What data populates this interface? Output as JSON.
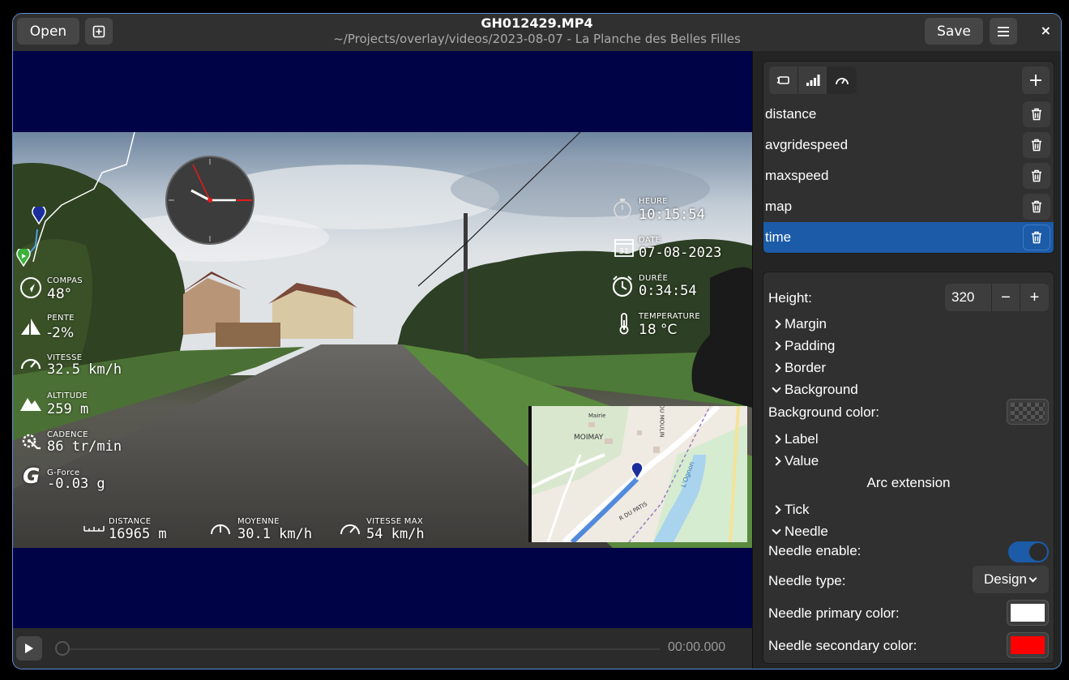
{
  "titlebar": {
    "open_label": "Open",
    "title": "GH012429.MP4",
    "subtitle": "~/Projects/overlay/videos/2023-08-07 - La Planche des Belles Filles",
    "save_label": "Save",
    "close_symbol": "×"
  },
  "overlay": {
    "compass": {
      "label": "COMPAS",
      "value": "48°"
    },
    "slope": {
      "label": "PENTE",
      "value": "-2%"
    },
    "speed": {
      "label": "VITESSE",
      "value": "32.5 km/h"
    },
    "altitude": {
      "label": "ALTITUDE",
      "value": "259 m"
    },
    "cadence": {
      "label": "CADENCE",
      "value": "86 tr/min"
    },
    "gforce": {
      "label": "G-Force",
      "value": "-0.03 g",
      "icon_letter": "G"
    },
    "hour": {
      "label": "HEURE",
      "value": "10:15:54"
    },
    "date": {
      "label": "DATE",
      "value": "07-08-2023",
      "icon_day": "31"
    },
    "duration": {
      "label": "DURÉE",
      "value": "0:34:54"
    },
    "temperature": {
      "label": "TEMPERATURE",
      "value": "18 °C"
    },
    "distance": {
      "label": "DISTANCE",
      "value": "16965 m"
    },
    "average": {
      "label": "MOYENNE",
      "value": "30.1 km/h"
    },
    "maxspeed": {
      "label": "VITESSE MAX",
      "value": "54 km/h"
    },
    "map_labels": {
      "town": "MOIMAY",
      "mairie": "Mairie",
      "river": "L'Ognon",
      "street1": "R DU PATIS",
      "street2": "RUE DU MOULIN"
    }
  },
  "playback": {
    "time": "00:00.000"
  },
  "widgets": {
    "items": [
      {
        "label": "distance"
      },
      {
        "label": "avgridespeed"
      },
      {
        "label": "maxspeed"
      },
      {
        "label": "map"
      },
      {
        "label": "time"
      }
    ]
  },
  "properties": {
    "height_label": "Height:",
    "height_value": "320",
    "margin": "Margin",
    "padding": "Padding",
    "border": "Border",
    "background": "Background",
    "background_color_label": "Background color:",
    "label": "Label",
    "value": "Value",
    "arc_extension": "Arc extension",
    "tick": "Tick",
    "needle": "Needle",
    "needle_enable_label": "Needle enable:",
    "needle_type_label": "Needle type:",
    "needle_type_value": "Design",
    "needle_primary_label": "Needle primary color:",
    "needle_secondary_label": "Needle secondary color:",
    "needle_primary_color": "#ffffff",
    "needle_secondary_color": "#ff0000"
  },
  "icons": [
    "new-tab-icon",
    "menu-icon",
    "close-icon",
    "play-icon",
    "camera-icon",
    "signal-icon",
    "gauge-icon",
    "plus-icon",
    "trash-icon",
    "compass-icon",
    "slope-icon",
    "speedometer-icon",
    "mountain-icon",
    "cadence-icon",
    "stopwatch-icon",
    "calendar-icon",
    "clock-icon",
    "thermometer-icon"
  ]
}
